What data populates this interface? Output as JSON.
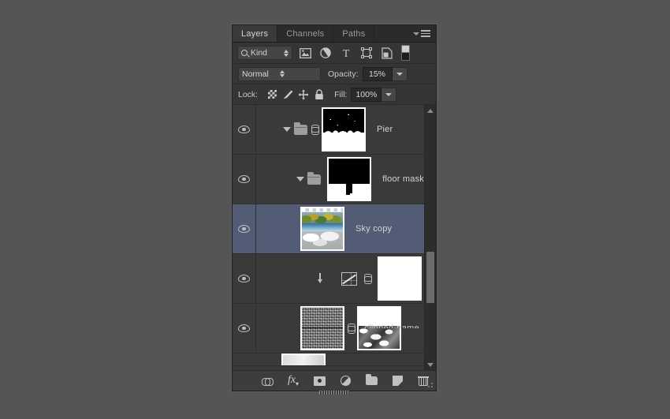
{
  "panel": {
    "tabs": [
      {
        "label": "Layers",
        "active": true
      },
      {
        "label": "Channels",
        "active": false
      },
      {
        "label": "Paths",
        "active": false
      }
    ],
    "menu_icon": "panel-menu-icon"
  },
  "filter_bar": {
    "kind_label": "Kind",
    "search_icon": "magnifier-icon",
    "filters": [
      {
        "icon": "pixel-layer-filter-icon"
      },
      {
        "icon": "adjustment-layer-filter-icon"
      },
      {
        "icon": "type-layer-filter-icon",
        "glyph": "T"
      },
      {
        "icon": "shape-layer-filter-icon"
      },
      {
        "icon": "smart-object-filter-icon"
      }
    ],
    "toggle_icon": "filter-toggle-switch"
  },
  "blend_bar": {
    "blend_mode": "Normal",
    "opacity_label": "Opacity:",
    "opacity_value": "15%"
  },
  "lock_bar": {
    "lock_label": "Lock:",
    "lock_icons": [
      "lock-transparent-pixels-icon",
      "lock-image-pixels-icon",
      "lock-position-icon",
      "lock-all-icon"
    ],
    "fill_label": "Fill:",
    "fill_value": "100%"
  },
  "layers": [
    {
      "name": "Pier",
      "visible": true,
      "selected": false,
      "indent": 0,
      "type": "group",
      "expanded": true,
      "linked": true,
      "thumb": "pier-mask-thumbnail"
    },
    {
      "name": "floor mask",
      "visible": true,
      "selected": false,
      "indent": 1,
      "type": "group",
      "expanded": true,
      "linked": false,
      "thumb": "floor-mask-thumbnail"
    },
    {
      "name": "Sky copy",
      "visible": true,
      "selected": true,
      "indent": 1,
      "type": "image",
      "thumb": "sky-copy-thumbnail"
    },
    {
      "name": "",
      "visible": true,
      "selected": false,
      "indent": 1,
      "type": "adjustment-curves",
      "clipped": true,
      "linked": true,
      "thumb": "white-layer-mask-thumbnail"
    },
    {
      "name": "",
      "visible": true,
      "selected": false,
      "indent": 1,
      "type": "image",
      "linked": true,
      "thumb": "noise-texture-thumbnail",
      "mask_thumb": "cloud-mask-thumbnail",
      "clipped_text": "clipped-name"
    }
  ],
  "scrollbar": {
    "up_arrow": "scroll-up-arrow",
    "down_arrow": "scroll-down-arrow"
  },
  "bottom_bar": {
    "buttons": [
      {
        "name": "link-layers-button",
        "icon": "link-icon"
      },
      {
        "name": "layer-style-button",
        "icon": "fx-icon",
        "glyph": "fx"
      },
      {
        "name": "add-layer-mask-button",
        "icon": "mask-icon"
      },
      {
        "name": "new-adjustment-layer-button",
        "icon": "adjustment-icon"
      },
      {
        "name": "new-group-button",
        "icon": "folder-icon"
      },
      {
        "name": "new-layer-button",
        "icon": "new-layer-icon"
      },
      {
        "name": "delete-layer-button",
        "icon": "trash-icon"
      }
    ]
  },
  "colors": {
    "panel_bg": "#323232",
    "row_bg": "#3a3a3a",
    "selected_row": "#525d75",
    "text": "#d2d2d2",
    "desktop_bg": "#555555"
  }
}
